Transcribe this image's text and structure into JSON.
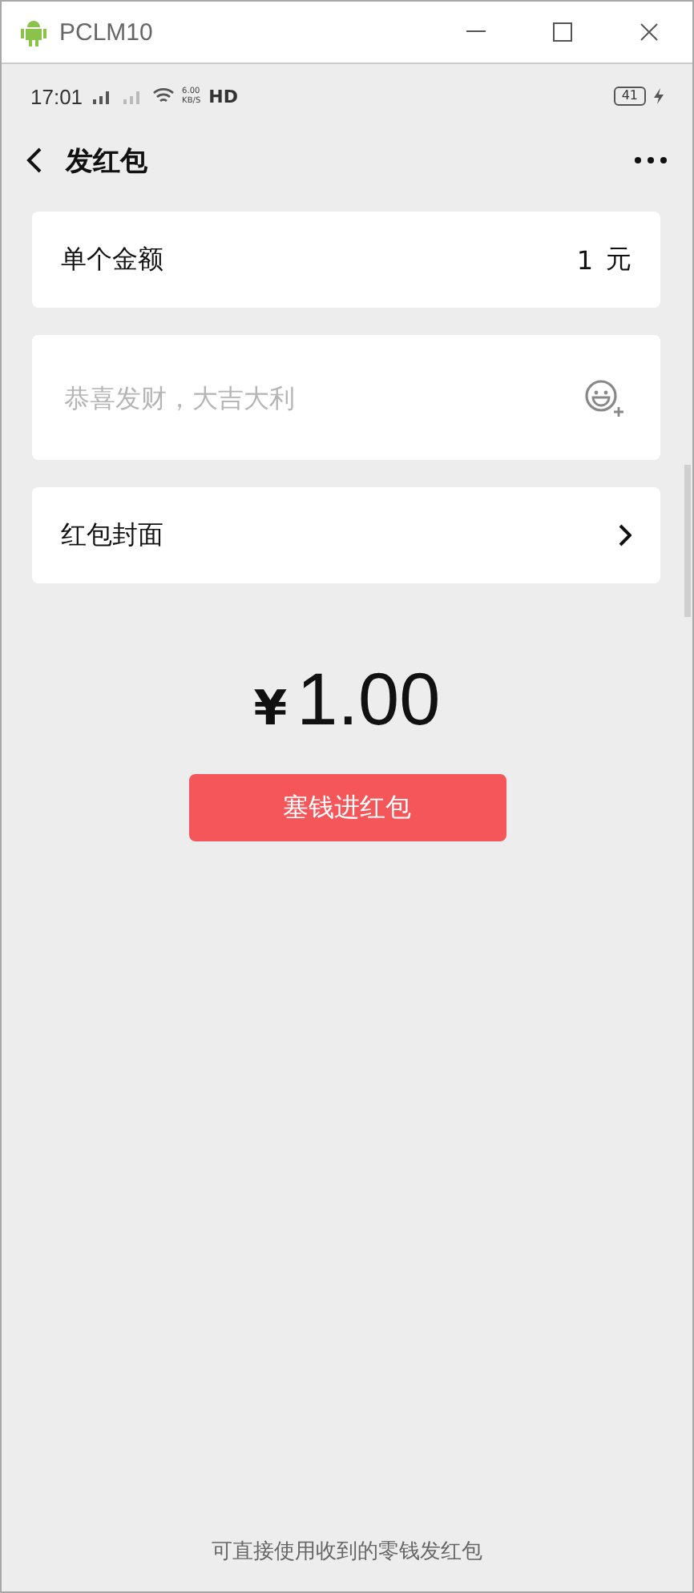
{
  "window": {
    "title": "PCLM10"
  },
  "status_bar": {
    "time": "17:01",
    "speed_value": "6.00",
    "speed_unit": "KB/S",
    "network": "HD",
    "battery": "41",
    "charging": true
  },
  "header": {
    "title": "发红包"
  },
  "amount_row": {
    "label": "单个金额",
    "value": "1",
    "unit": "元"
  },
  "message_field": {
    "placeholder": "恭喜发财，大吉大利"
  },
  "cover_row": {
    "label": "红包封面"
  },
  "total": {
    "currency": "¥",
    "amount": "1.00"
  },
  "submit_button": {
    "label": "塞钱进红包"
  },
  "footer_note": "可直接使用收到的零钱发红包"
}
